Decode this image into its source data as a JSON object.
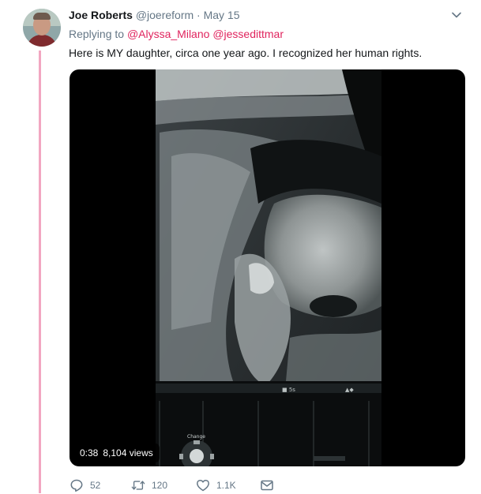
{
  "tweet": {
    "author_name": "Joe Roberts",
    "handle": "@joereform",
    "separator": " · ",
    "date": "May 15",
    "replying_label": "Replying to ",
    "replying_to": [
      "@Alyssa_Milano",
      "@jessedittmar"
    ],
    "text": "Here is MY daughter, circa one year ago. I recognized her human rights."
  },
  "media": {
    "duration": "0:38",
    "views": "8,104 views",
    "screen_label": "Change"
  },
  "actions": {
    "reply_count": "52",
    "retweet_count": "120",
    "like_count": "1.1K"
  },
  "icons": {
    "menu": "chevron-down-icon",
    "reply": "reply-icon",
    "retweet": "retweet-icon",
    "like": "heart-icon",
    "dm": "envelope-icon"
  },
  "colors": {
    "link": "#e0245e",
    "thread_line": "#f2a6c1",
    "muted": "#657786"
  }
}
